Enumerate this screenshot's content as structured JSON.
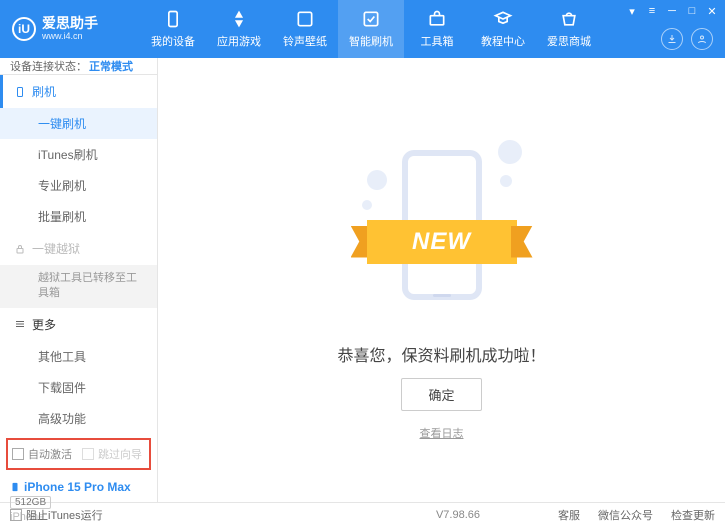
{
  "header": {
    "logo_title": "爱思助手",
    "logo_sub": "www.i4.cn",
    "logo_letter": "iU",
    "tabs": [
      "我的设备",
      "应用游戏",
      "铃声壁纸",
      "智能刷机",
      "工具箱",
      "教程中心",
      "爱思商城"
    ]
  },
  "sidebar": {
    "status_label": "设备连接状态：",
    "status_mode": "正常模式",
    "sec_flash": "刷机",
    "items_flash": [
      "一键刷机",
      "iTunes刷机",
      "专业刷机",
      "批量刷机"
    ],
    "sec_jailbreak": "一键越狱",
    "jailbreak_note": "越狱工具已转移至工具箱",
    "sec_more": "更多",
    "items_more": [
      "其他工具",
      "下载固件",
      "高级功能"
    ],
    "chk_auto": "自动激活",
    "chk_skip": "跳过向导",
    "device_name": "iPhone 15 Pro Max",
    "device_storage": "512GB",
    "device_type": "iPhone"
  },
  "main": {
    "ribbon": "NEW",
    "success": "恭喜您，保资料刷机成功啦！",
    "ok": "确定",
    "log_link": "查看日志"
  },
  "footer": {
    "block_itunes": "阻止iTunes运行",
    "version": "V7.98.66",
    "links": [
      "客服",
      "微信公众号",
      "检查更新"
    ]
  }
}
